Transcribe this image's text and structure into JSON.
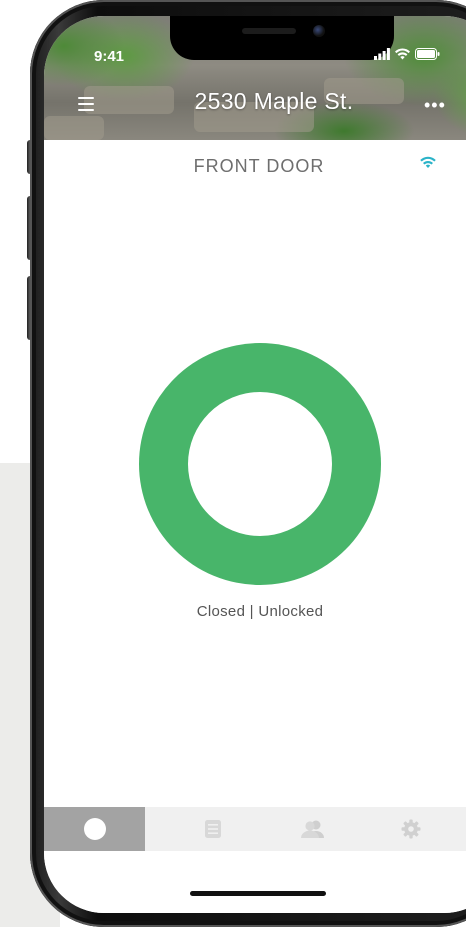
{
  "status_bar": {
    "time": "9:41"
  },
  "header": {
    "title": "2530 Maple St.",
    "menu_icon": "hamburger-menu-icon",
    "more_icon": "ellipsis-icon"
  },
  "door": {
    "name": "FRONT DOOR",
    "connection_icon": "wifi-icon",
    "status": "Closed | Unlocked",
    "ring_color": "#48b56a"
  },
  "tabs": [
    {
      "icon": "status-dot-icon",
      "active": true
    },
    {
      "icon": "list-icon",
      "active": false
    },
    {
      "icon": "users-icon",
      "active": false
    },
    {
      "icon": "gear-icon",
      "active": false
    }
  ],
  "colors": {
    "accent_green": "#48b56a",
    "wifi_teal": "#2bb3c8",
    "tab_active": "#a3a3a3",
    "tab_bar": "#f0f0f0"
  }
}
